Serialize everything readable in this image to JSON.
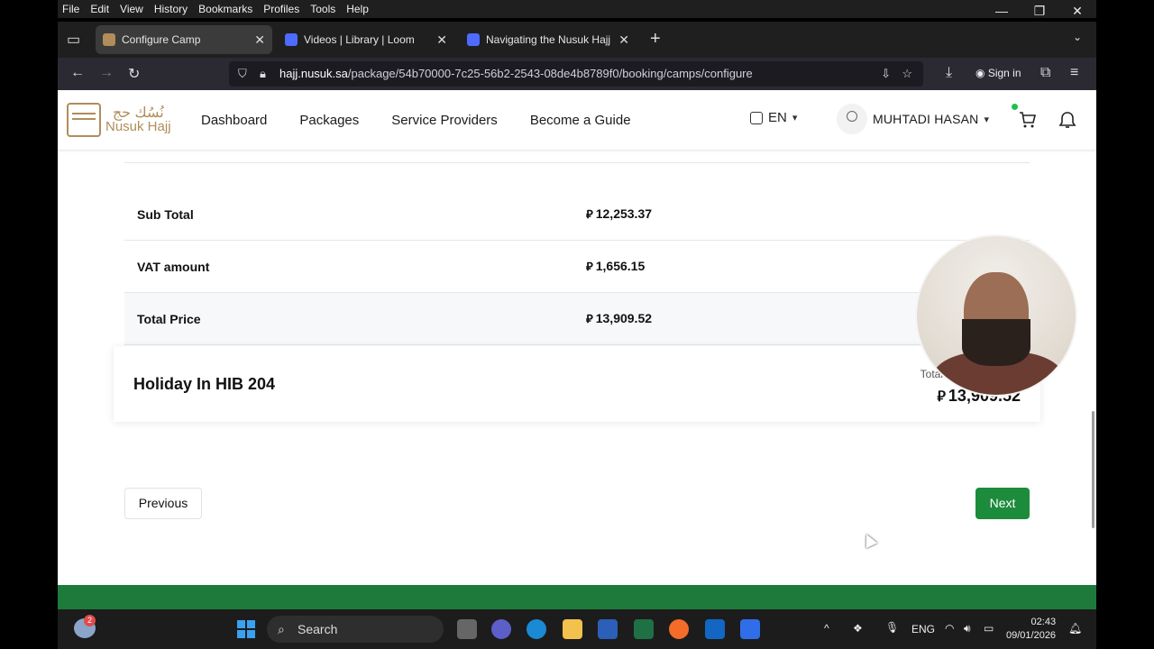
{
  "browser": {
    "menu": [
      "File",
      "Edit",
      "View",
      "History",
      "Bookmarks",
      "Profiles",
      "Tools",
      "Help"
    ],
    "tabs": [
      {
        "title": "Configure Camp",
        "active": true
      },
      {
        "title": "Videos | Library | Loom",
        "active": false
      },
      {
        "title": "Navigating the Nusuk Hajj Platf",
        "active": false
      }
    ],
    "url_host": "hajj.nusuk.sa",
    "url_path": "/package/54b70000-7c25-56b2-2543-08de4b8789f0/booking/camps/configure",
    "sign_in": "Sign in"
  },
  "site": {
    "logo_arabic": "نُسُك حج",
    "logo_text": "Nusuk Hajj",
    "nav": [
      "Dashboard",
      "Packages",
      "Service Providers",
      "Become a Guide"
    ],
    "language": "EN",
    "user_name": "MUHTADI HASAN"
  },
  "summary": {
    "currency_symbol": "⃁",
    "rows": [
      {
        "label": "Sub Total",
        "value": "12,253.37"
      },
      {
        "label": "VAT amount",
        "value": "1,656.15"
      },
      {
        "label": "Total Price",
        "value": "13,909.52"
      }
    ]
  },
  "camp_card": {
    "name": "Holiday In HIB 204",
    "total_label": "Total",
    "total_value": "13,909.52"
  },
  "actions": {
    "previous": "Previous",
    "next": "Next"
  },
  "taskbar": {
    "search_placeholder": "Search",
    "weather_badge": "2",
    "language": "ENG",
    "time": "02:43",
    "date": "09/01/2026"
  },
  "colors": {
    "brand_green": "#1d8b3c",
    "footer_green": "#1d7a3a",
    "logo_gold": "#b08d5a"
  }
}
